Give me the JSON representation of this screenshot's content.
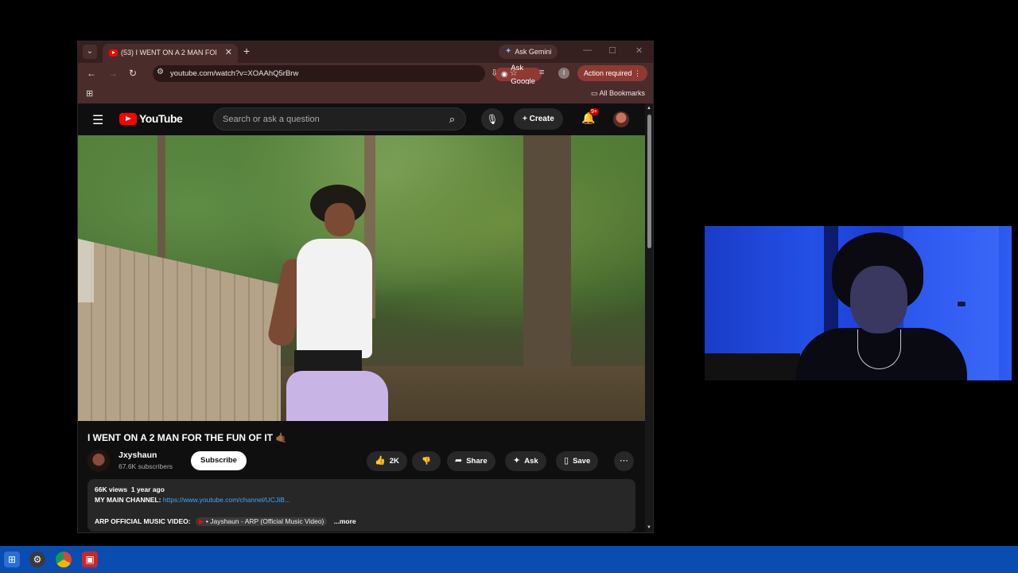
{
  "browser": {
    "tab_title": "(53) I WENT ON A 2 MAN FOR",
    "tab_close": "✕",
    "new_tab": "+",
    "gemini_label": "Ask Gemini",
    "window_controls": [
      "—",
      "☐",
      "✕"
    ],
    "url": "youtube.com/watch?v=XOAAhQ5rBrw",
    "ask_google_label": "Ask Google",
    "profile_initial": "I",
    "action_required_label": "Action required",
    "all_bookmarks_label": "All Bookmarks"
  },
  "youtube": {
    "logo_text": "YouTube",
    "search_placeholder": "Search or ask a question",
    "create_label": "Create",
    "notification_badge": "9+",
    "video_title": "I WENT ON A 2 MAN FOR THE FUN OF IT 🤙🏾",
    "channel_name": "Jxyshaun",
    "channel_subscribers": "67.6K subscribers",
    "subscribe_label": "Subscribe",
    "like_count": "2K",
    "share_label": "Share",
    "ask_label": "Ask",
    "save_label": "Save",
    "description": {
      "views": "66K views",
      "age": "1 year ago",
      "main_channel_label": "MY MAIN CHANNEL:",
      "main_channel_link": "https://www.youtube.com/channel/UCJiB...",
      "music_video_label": "ARP OFFICIAL MUSIC VIDEO:",
      "music_video_chip": "• Jayshaun - ARP (Official Music Video)",
      "more_label": "...more"
    }
  },
  "colors": {
    "tabstrip": "#35201f",
    "toolbar": "#4a2c2b",
    "accent_button": "#8e3a33",
    "youtube_red": "#ff0000",
    "link_blue": "#3ea6ff",
    "taskbar": "#0a4cb0"
  },
  "icons": [
    "tab-search-icon",
    "back-icon",
    "forward-icon",
    "reload-icon",
    "site-info-icon",
    "install-icon",
    "bookmark-star-icon",
    "extensions-icon",
    "kebab-menu-icon",
    "apps-grid-icon",
    "folder-icon",
    "hamburger-icon",
    "search-icon",
    "mic-icon",
    "plus-icon",
    "bell-icon",
    "like-icon",
    "dislike-icon",
    "share-icon",
    "sparkle-icon",
    "save-icon",
    "more-icon",
    "windows-start-icon",
    "chrome-icon"
  ]
}
